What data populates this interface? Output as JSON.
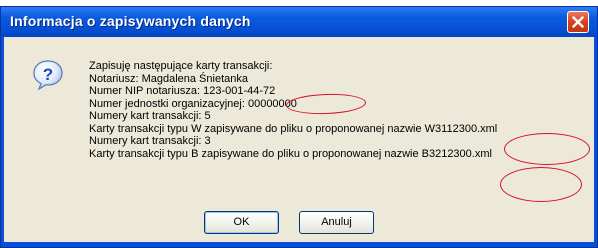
{
  "dialog": {
    "title": "Informacja o zapisywanych danych",
    "icon": "question-icon",
    "lines": [
      "Zapisuję następujące karty transakcji:",
      "Notariusz: Magdalena Śnietanka",
      "Numer NIP notariusza: 123-001-44-72",
      "Numer jednostki organizacyjnej: 00000000",
      "Numery kart transakcji: 5",
      "Karty transakcji typu W zapisywane do pliku o proponowanej nazwie W3112300.xml",
      "Numery kart transakcji: 3",
      "Karty transakcji typu B zapisywane do pliku o proponowanej nazwie B3212300.xml"
    ],
    "buttons": {
      "ok": "OK",
      "cancel": "Anuluj"
    }
  },
  "colors": {
    "titlebar": "#0653d8",
    "client": "#ece9d8",
    "annotation": "#d8102a",
    "close": "#d8421c"
  }
}
